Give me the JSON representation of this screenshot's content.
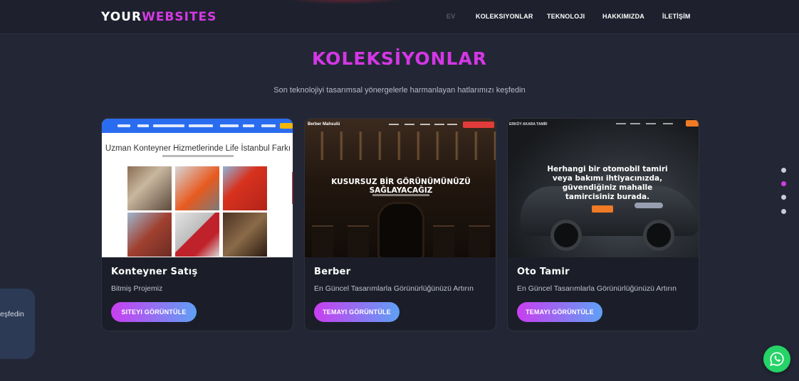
{
  "header": {
    "logo_part1": "YOUR",
    "logo_part2": "WEBSITES",
    "nav": [
      "EV",
      "KOLEKSIYONLAR",
      "TEKNOLOJI",
      "HAKKIMIZDA",
      "İLETİŞİM"
    ]
  },
  "section": {
    "title": "KOLEKSİYONLAR",
    "subtitle": "Son teknolojiyi tasarımsal yönergelerle harmanlayan hatlarımızı keşfedin"
  },
  "cards": [
    {
      "title": "Konteyner Satış",
      "description": "Bitmiş Projemiz",
      "button": "SITEYI GÖRÜNTÜLE",
      "preview_heading": "Uzman Konteyner Hizmetlerinde Life İstanbul Farkı"
    },
    {
      "title": "Berber",
      "description": "En Güncel Tasarımlarla Görünürlüğünüzü Artırın",
      "button": "TEMAYI GÖRÜNTÜLE",
      "preview_brand": "Berber Mahsulü",
      "preview_heading": "KUSURSUZ BİR GÖRÜNÜMÜNÜZÜ SAĞLAYACAĞIZ"
    },
    {
      "title": "Oto Tamir",
      "description": "En Güncel Tasarımlarla Görünürlüğünüzü Artırın",
      "button": "TEMAYI GÖRÜNTÜLE",
      "preview_brand": "ERKÖY AKARA TAMİR",
      "preview_heading": "Herhangi bir otomobil tamiri veya bakımı ihtiyacınızda, güvendiğiniz mahalle tamircisiniz burada."
    }
  ],
  "pager": {
    "count": 4,
    "active_index": 1
  },
  "side_panel": {
    "text": "eşfedin"
  },
  "colors": {
    "accent": "#d63ae6",
    "background": "#232735",
    "whatsapp": "#25d366"
  },
  "icons": {
    "floating_button": "whatsapp-icon"
  }
}
